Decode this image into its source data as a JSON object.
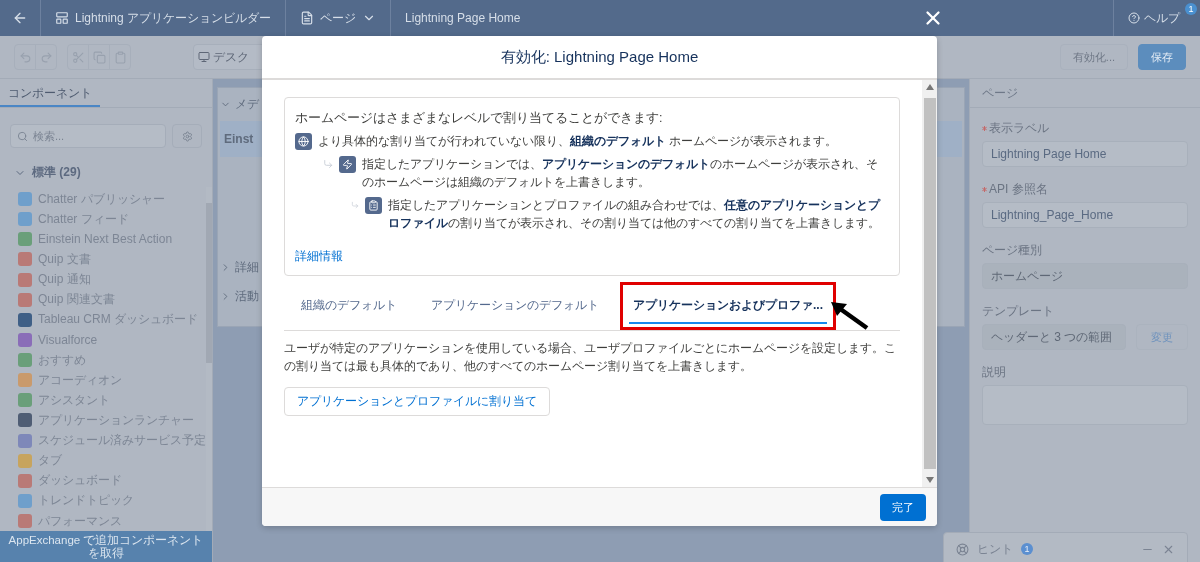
{
  "top_bar": {
    "app_name": "Lightning アプリケーションビルダー",
    "page_menu": "ページ",
    "page_title": "Lightning Page Home",
    "help": "ヘルプ",
    "help_badge": "1"
  },
  "toolbar": {
    "device": "デスク",
    "activate": "有効化...",
    "save": "保存"
  },
  "left_panel": {
    "tab": "コンポーネント",
    "search": {
      "placeholder": "検索..."
    },
    "section": {
      "label": "標準 (29)",
      "expanded": true
    },
    "items": [
      {
        "label": "Chatter パブリッシャー",
        "color": "#6f9fcb"
      },
      {
        "label": "Chatter フィード",
        "color": "#6f9fcb"
      },
      {
        "label": "Einstein Next Best Action",
        "color": "#6a9f7a"
      },
      {
        "label": "Quip 文書",
        "color": "#b97a77"
      },
      {
        "label": "Quip 通知",
        "color": "#b97a77"
      },
      {
        "label": "Quip 関連文書",
        "color": "#b97a77"
      },
      {
        "label": "Tableau CRM ダッシュボード",
        "color": "#3f5f86"
      },
      {
        "label": "Visualforce",
        "color": "#8a6db8"
      },
      {
        "label": "おすすめ",
        "color": "#6a9f7a"
      },
      {
        "label": "アコーディオン",
        "color": "#c99a6c"
      },
      {
        "label": "アシスタント",
        "color": "#6a9f7a"
      },
      {
        "label": "アプリケーションランチャー",
        "color": "#4f5d74"
      },
      {
        "label": "スケジュール済みサービス予定",
        "color": "#7e88b9"
      },
      {
        "label": "タブ",
        "color": "#c7a45e"
      },
      {
        "label": "ダッシュボード",
        "color": "#b97a77"
      },
      {
        "label": "トレンドトピック",
        "color": "#6f9fcb"
      },
      {
        "label": "パフォーマンス",
        "color": "#b97a77"
      }
    ],
    "footer": "AppExchange で追加コンポーネントを取得"
  },
  "canvas": {
    "header": "メデ",
    "card_title": "Einst",
    "sections": [
      {
        "label": "詳細",
        "expanded": false
      },
      {
        "label": "活動",
        "expanded": false
      }
    ]
  },
  "right_panel": {
    "title": "ページ",
    "fields": [
      {
        "kind": "input",
        "label": "表示ラベル",
        "required": true,
        "value": "Lightning Page Home"
      },
      {
        "kind": "input",
        "label": "API 参照名",
        "required": true,
        "value": "Lightning_Page_Home"
      },
      {
        "kind": "readonly",
        "label": "ページ種別",
        "required": false,
        "value": "ホームページ"
      },
      {
        "kind": "readonly",
        "label": "テンプレート",
        "required": false,
        "value": "ヘッダーと 3 つの範囲",
        "button": "変更"
      },
      {
        "kind": "textarea",
        "label": "説明",
        "required": false
      }
    ]
  },
  "hint": {
    "label": "ヒント",
    "badge": "1"
  },
  "modal": {
    "title": "有効化: Lightning Page Home",
    "intro": "ホームページはさまざまなレベルで割り当てることができます:",
    "levels": [
      {
        "text": "より具体的な割り当てが行われていない限り、**組織のデフォルト** ホームページが表示されます。",
        "children": [
          {
            "text": "指定したアプリケーションでは、**アプリケーションのデフォルト**のホームページが表示され、そのホームページは組織のデフォルトを上書きします。",
            "children": [
              {
                "text": "指定したアプリケーションとプロファイルの組み合わせでは、**任意のアプリケーションとプロファイル**の割り当てが表示され、その割り当ては他のすべての割り当てを上書きします。"
              }
            ]
          }
        ]
      }
    ],
    "link": "詳細情報",
    "tabs": [
      {
        "label": "組織のデフォルト",
        "selected": false
      },
      {
        "label": "アプリケーションのデフォルト",
        "selected": false
      },
      {
        "label": "アプリケーションおよびプロファ...",
        "selected": true
      }
    ],
    "description": "ユーザが特定のアプリケーションを使用している場合、ユーザプロファイルごとにホームページを設定します。この割り当ては最も具体的であり、他のすべてのホームページ割り当てを上書きします。",
    "assign_button": "アプリケーションとプロファイルに割り当て",
    "done": "完了"
  }
}
